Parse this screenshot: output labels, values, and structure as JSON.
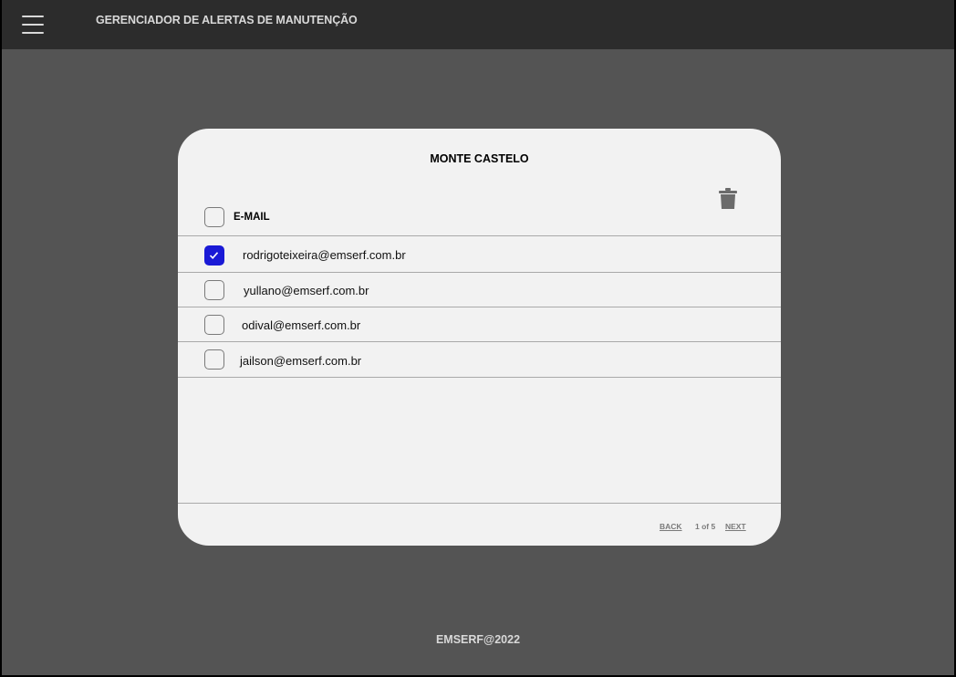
{
  "header": {
    "title": "GERENCIADOR DE ALERTAS DE MANUTENÇÃO",
    "menu_icon": "hamburger-menu-icon"
  },
  "card": {
    "title": "MONTE CASTELO",
    "delete_icon": "trash-icon",
    "column_header": "E-MAIL",
    "rows": [
      {
        "email": "rodrigoteixeira@emserf.com.br",
        "checked": true
      },
      {
        "email": "yullano@emserf.com.br",
        "checked": false
      },
      {
        "email": "odival@emserf.com.br",
        "checked": false
      },
      {
        "email": "jailson@emserf.com.br",
        "checked": false
      }
    ],
    "pagination": {
      "back_label": "BACK",
      "page_indicator": "1 of 5",
      "next_label": "NEXT"
    }
  },
  "footer": {
    "text": "EMSERF@2022"
  },
  "colors": {
    "topbar": "#2c2c2c",
    "background": "#545454",
    "card": "#f2f2f2",
    "checkbox_checked": "#1a1ad6"
  }
}
